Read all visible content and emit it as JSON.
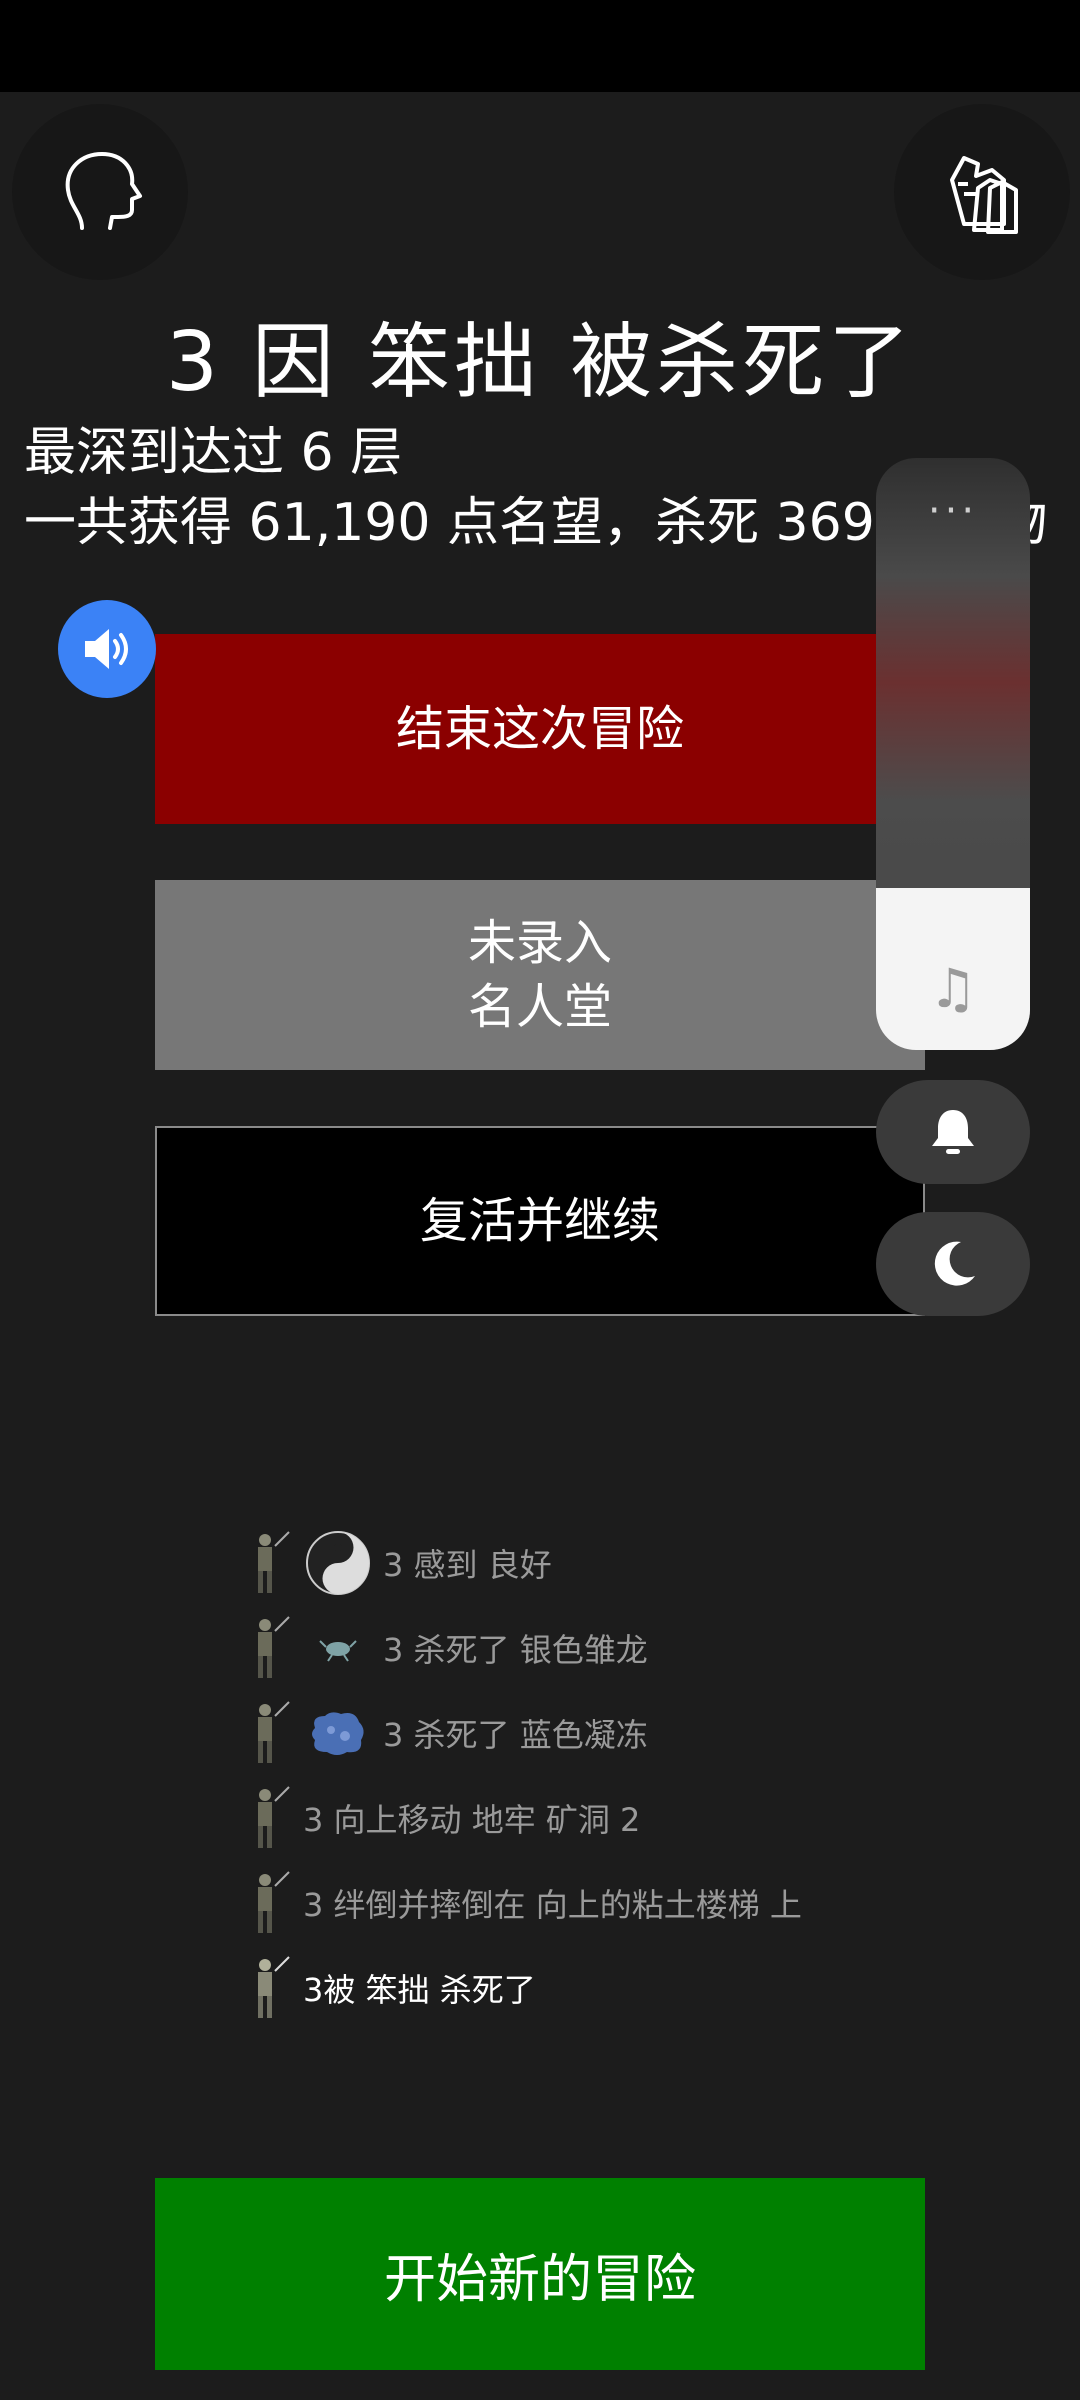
{
  "header": {
    "title": "3 因 笨拙 被杀死了",
    "deepest": "最深到达过 6 层",
    "reputation": "一共获得 61,190 点名望，杀死 369 只怪物"
  },
  "actions": {
    "end": "结束这次冒险",
    "hof_line1": "未录入",
    "hof_line2": "名人堂",
    "revive": "复活并继续",
    "new_adventure": "开始新的冒险"
  },
  "overlay": {
    "more": "···"
  },
  "log": [
    {
      "text": "3 感到 良好",
      "icon": "yin-yang-icon"
    },
    {
      "text": "3 杀死了 银色雏龙",
      "icon": "silver-dragon-icon"
    },
    {
      "text": "3 杀死了 蓝色凝冻",
      "icon": "blue-jelly-icon"
    },
    {
      "text": "3 向上移动 地牢 矿洞 2",
      "icon": null
    },
    {
      "text": "3 绊倒并摔倒在 向上的粘土楼梯 上",
      "icon": null
    },
    {
      "text": "3被 笨拙 杀死了",
      "icon": null
    }
  ],
  "colors": {
    "end_button": "#8b0000",
    "hof_button": "#777777",
    "new_button": "#008000",
    "sound_fab": "#3b82f6"
  }
}
